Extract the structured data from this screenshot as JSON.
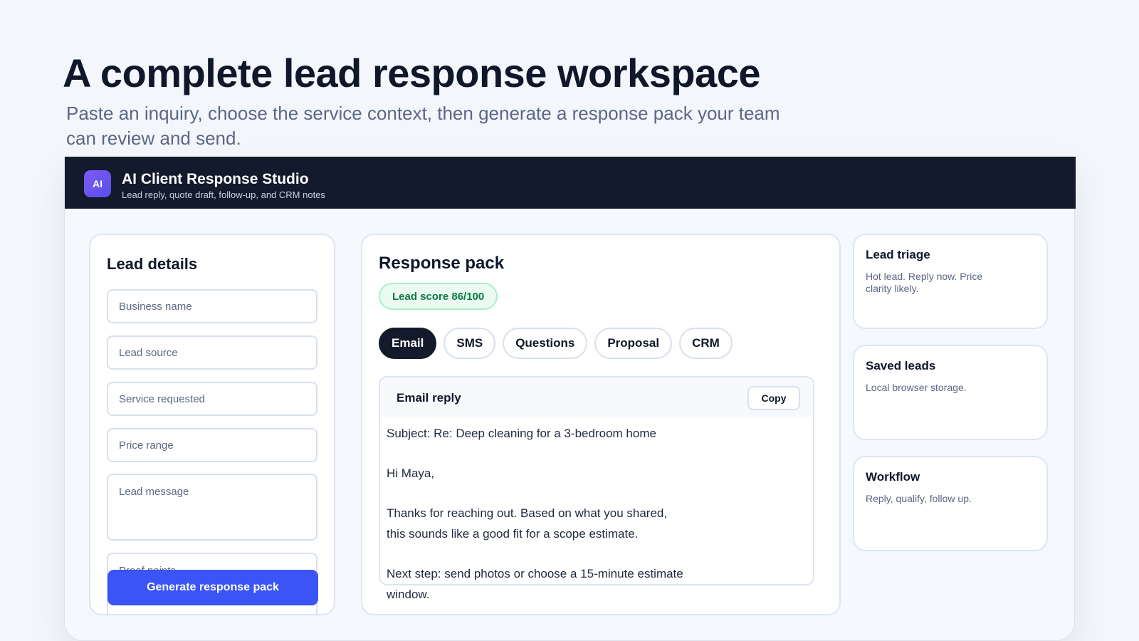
{
  "hero": {
    "title": "A complete lead response workspace",
    "subtitle": "Paste an inquiry, choose the service context, then generate a response pack your team can review and send."
  },
  "app": {
    "logo_text": "AI",
    "title": "AI Client Response Studio",
    "subtitle": "Lead reply, quote draft, follow-up, and CRM notes"
  },
  "lead_details": {
    "title": "Lead details",
    "fields": {
      "business_name": "Business name",
      "lead_source": "Lead source",
      "service_requested": "Service requested",
      "price_range": "Price range",
      "lead_message": "Lead message",
      "proof_points": "Proof points"
    },
    "generate_label": "Generate response pack"
  },
  "response_pack": {
    "title": "Response pack",
    "score_badge": "Lead score 86/100",
    "tabs": [
      "Email",
      "SMS",
      "Questions",
      "Proposal",
      "CRM"
    ],
    "active_tab": "Email",
    "reply": {
      "title": "Email reply",
      "copy_label": "Copy",
      "subject": "Subject: Re: Deep cleaning for a 3-bedroom home",
      "greeting": "Hi Maya,",
      "paragraph": "Thanks for reaching out. Based on what you shared, this sounds like a good fit for a scope estimate.",
      "next_step": "Next step: send photos or choose a 15-minute estimate window."
    }
  },
  "sidebar": {
    "cards": [
      {
        "title": "Lead triage",
        "text": "Hot lead. Reply now. Price clarity likely."
      },
      {
        "title": "Saved leads",
        "text": "Local browser storage."
      },
      {
        "title": "Workflow",
        "text": "Reply, qualify, follow up."
      }
    ]
  },
  "colors": {
    "accent": "#3a54f5",
    "topbar": "#131a2b",
    "score_green": "#0b7a45"
  }
}
